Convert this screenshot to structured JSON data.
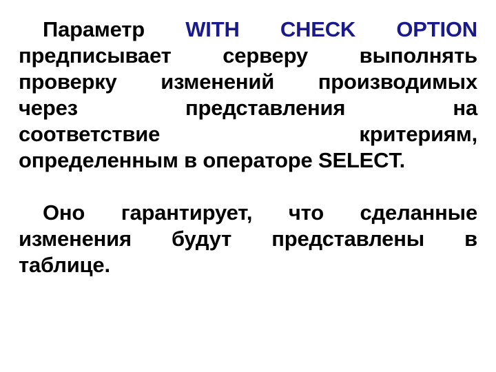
{
  "slide": {
    "background_color": "#ffffff",
    "text_color": "#000000",
    "keyword_color": "#1a1a8c",
    "paragraphs": [
      {
        "id": "p1",
        "lines": [
          {
            "id": "p1l1",
            "segments": [
              {
                "text": "Параметр ",
                "style": "normal"
              },
              {
                "text": "WITH  CHECK  OPTION",
                "style": "keyword"
              }
            ]
          },
          {
            "id": "p1l2",
            "text": "предписывает  серверу  выполнять"
          },
          {
            "id": "p1l3",
            "text": "проверку изменений производимых"
          },
          {
            "id": "p1l4",
            "text": "через   представления   на"
          },
          {
            "id": "p1l5",
            "text": "соответствие   критериям,"
          },
          {
            "id": "p1l6",
            "text": "определенным в операторе SELECT."
          }
        ],
        "plain": "Параметр WITH CHECK OPTION предписывает серверу выполнять проверку изменений производимых через представления на соответствие критериям, определенным в операторе SELECT."
      },
      {
        "id": "p2",
        "lines": [
          {
            "id": "p2l1",
            "text": "Оно  гарантирует,  что  сделанные"
          },
          {
            "id": "p2l2",
            "text": "изменения  будут  представлены  в"
          },
          {
            "id": "p2l3",
            "text": "таблице."
          }
        ],
        "plain": "Оно гарантирует, что сделанные изменения будут представлены в таблице."
      }
    ],
    "keyword_phrase": "WITH CHECK OPTION",
    "sql_statement": "SELECT"
  }
}
